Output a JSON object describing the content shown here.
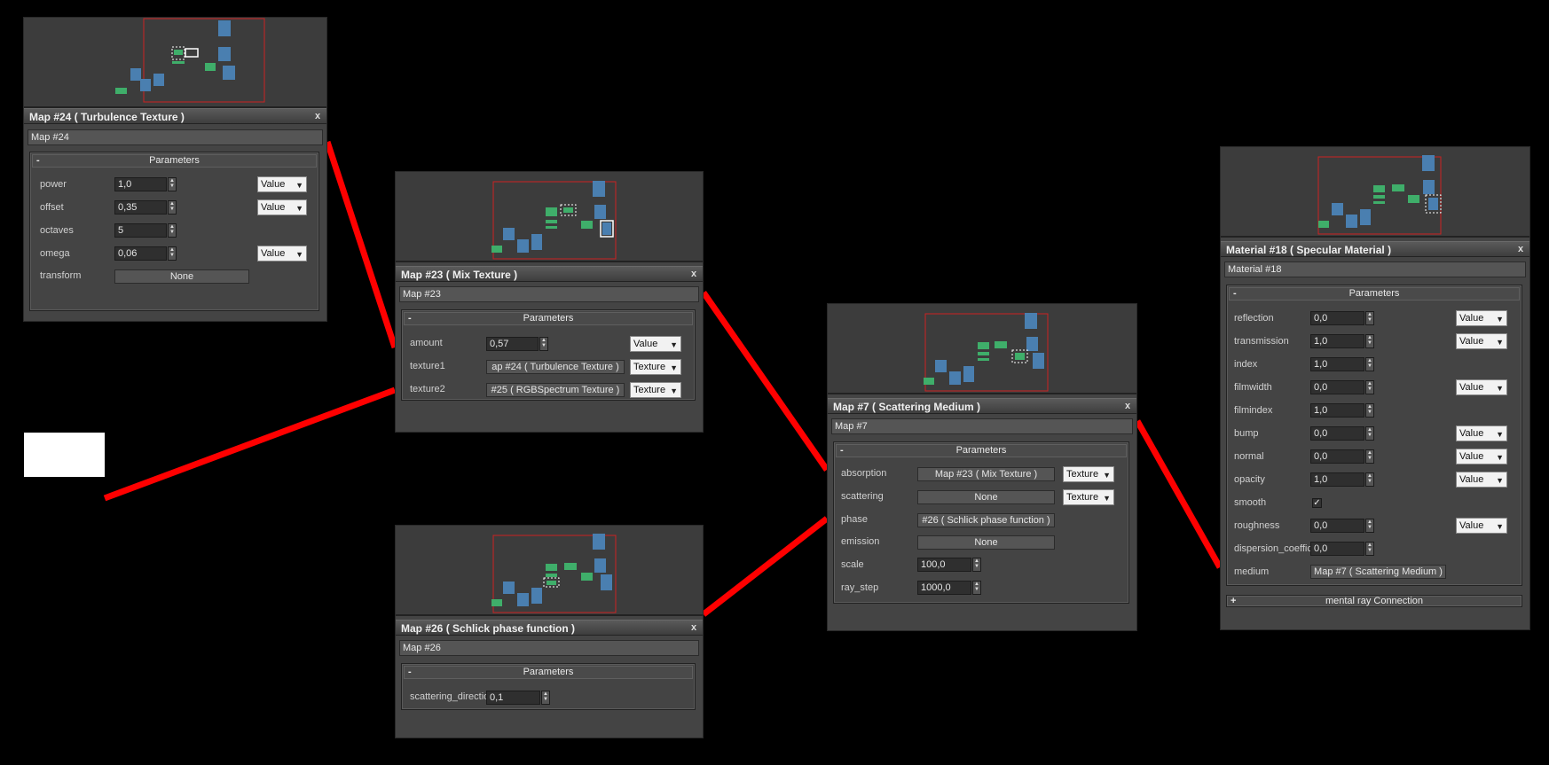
{
  "nodes": {
    "map24": {
      "title": "Map #24  ( Turbulence Texture )",
      "name": "Map #24",
      "rollout": "Parameters",
      "rollout_sign": "-",
      "params": [
        {
          "label": "power",
          "value": "1,0",
          "mode": "Value"
        },
        {
          "label": "offset",
          "value": "0,35",
          "mode": "Value"
        },
        {
          "label": "octaves",
          "value": "5"
        },
        {
          "label": "omega",
          "value": "0,06",
          "mode": "Value"
        },
        {
          "label": "transform",
          "map": "None"
        }
      ]
    },
    "map23": {
      "title": "Map #23  ( Mix Texture )",
      "name": "Map #23",
      "rollout": "Parameters",
      "rollout_sign": "-",
      "params": [
        {
          "label": "amount",
          "value": "0,57",
          "mode": "Value"
        },
        {
          "label": "texture1",
          "map": "ap #24  ( Turbulence Texture )",
          "mode": "Texture"
        },
        {
          "label": "texture2",
          "map": "#25  ( RGBSpectrum Texture )",
          "mode": "Texture"
        }
      ]
    },
    "map26": {
      "title": "Map #26  ( Schlick phase function )",
      "name": "Map #26",
      "rollout": "Parameters",
      "rollout_sign": "-",
      "params": [
        {
          "label": "scattering_directio",
          "value": "0,1"
        }
      ]
    },
    "map7": {
      "title": "Map #7  ( Scattering Medium )",
      "name": "Map #7",
      "rollout": "Parameters",
      "rollout_sign": "-",
      "params": [
        {
          "label": "absorption",
          "map": "Map #23  ( Mix Texture )",
          "mode": "Texture"
        },
        {
          "label": "scattering",
          "map": "None",
          "mode": "Texture"
        },
        {
          "label": "phase",
          "map": "#26  ( Schlick phase function )"
        },
        {
          "label": "emission",
          "map": "None"
        },
        {
          "label": "scale",
          "value": "100,0"
        },
        {
          "label": "ray_step",
          "value": "1000,0"
        }
      ]
    },
    "mat18": {
      "title": "Material #18  ( Specular Material )",
      "name": "Material #18",
      "rollout": "Parameters",
      "rollout_sign": "-",
      "params": [
        {
          "label": "reflection",
          "value": "0,0",
          "mode": "Value"
        },
        {
          "label": "transmission",
          "value": "1,0",
          "mode": "Value"
        },
        {
          "label": "index",
          "value": "1,0"
        },
        {
          "label": "filmwidth",
          "value": "0,0",
          "mode": "Value"
        },
        {
          "label": "filmindex",
          "value": "1,0"
        },
        {
          "label": "bump",
          "value": "0,0",
          "mode": "Value"
        },
        {
          "label": "normal",
          "value": "0,0",
          "mode": "Value"
        },
        {
          "label": "opacity",
          "value": "1,0",
          "mode": "Value"
        },
        {
          "label": "smooth",
          "checked": "✓"
        },
        {
          "label": "roughness",
          "value": "0,0",
          "mode": "Value"
        },
        {
          "label": "dispersion_coeffic",
          "value": "0,0"
        },
        {
          "label": "medium",
          "map": "Map #7  ( Scattering Medium )"
        }
      ],
      "extra_rollout": "mental ray Connection",
      "extra_rollout_sign": "+"
    }
  },
  "close_label": "x",
  "colors": {
    "wire": "#ff0000",
    "node_green": "#3fae6a",
    "node_blue": "#4a7fb0",
    "preview_frame": "#cc2222"
  }
}
